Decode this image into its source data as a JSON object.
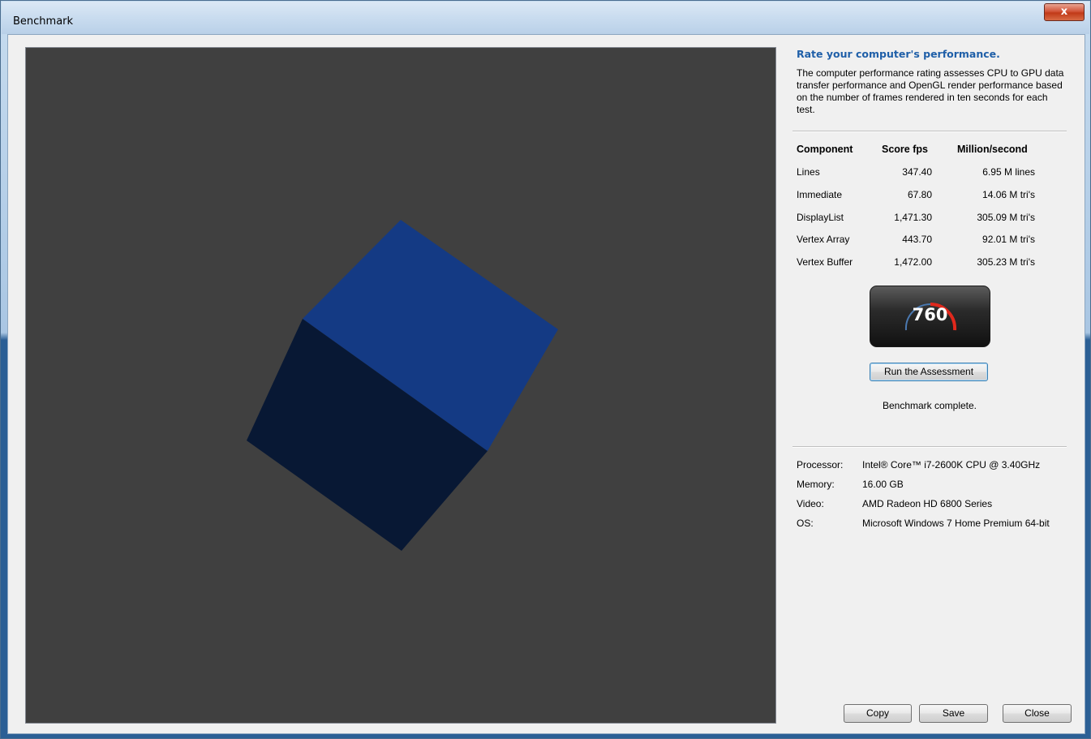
{
  "window": {
    "title": "Benchmark",
    "close_label": "x"
  },
  "panel": {
    "heading": "Rate your computer's performance.",
    "description": "The computer performance rating assesses CPU to GPU data transfer performance and OpenGL render performance based on the number of frames rendered in ten seconds for each test.",
    "table": {
      "headers": [
        "Component",
        "Score fps",
        "Million/second"
      ],
      "rows": [
        {
          "component": "Lines",
          "score": "347.40",
          "rate": "6.95 M lines"
        },
        {
          "component": "Immediate",
          "score": "67.80",
          "rate": "14.06 M tri's"
        },
        {
          "component": "DisplayList",
          "score": "1,471.30",
          "rate": "305.09 M tri's"
        },
        {
          "component": "Vertex Array",
          "score": "443.70",
          "rate": "92.01 M tri's"
        },
        {
          "component": "Vertex Buffer",
          "score": "1,472.00",
          "rate": "305.23 M tri's"
        }
      ]
    },
    "rating": "760",
    "run_button": "Run the Assessment",
    "status": "Benchmark complete.",
    "system": {
      "processor_label": "Processor:",
      "processor": "Intel® Core™ i7-2600K CPU @ 3.40GHz",
      "memory_label": "Memory:",
      "memory": "16.00 GB",
      "video_label": "Video:",
      "video": "AMD Radeon HD 6800 Series",
      "os_label": "OS:",
      "os": "Microsoft Windows 7 Home Premium 64-bit"
    },
    "buttons": {
      "copy": "Copy",
      "save": "Save",
      "close": "Close"
    }
  },
  "colors": {
    "viewport_bg": "#404040",
    "cube_top": "#143a84",
    "cube_front": "#081834",
    "heading": "#1f5fa8",
    "gauge_red": "#e0281c"
  },
  "icons": {
    "close": "close-icon",
    "gauge": "speedometer-icon"
  }
}
